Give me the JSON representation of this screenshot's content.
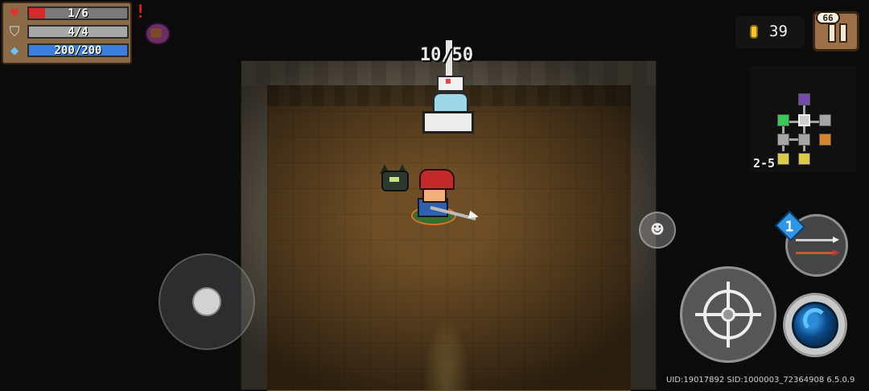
{
  "hud": {
    "health": {
      "icon": "heart-icon",
      "text": "1/6",
      "current": 1,
      "max": 6,
      "color": "#d62a2a"
    },
    "armor": {
      "icon": "shield-icon",
      "text": "4/4",
      "current": 4,
      "max": 4,
      "color": "#a7a7a7"
    },
    "energy": {
      "icon": "diamond-icon",
      "text": "200/200",
      "current": 200,
      "max": 200,
      "color": "#3a7ee0"
    },
    "alert": "!",
    "buff_icon": "purple-pouch-icon"
  },
  "gold": {
    "icon": "coin-icon",
    "value": "39"
  },
  "pause": {
    "badge": "66",
    "icon": "pause-icon"
  },
  "minimap": {
    "level": "2-5"
  },
  "machine": {
    "counter": "10/50"
  },
  "controls": {
    "joystick": "virtual-joystick",
    "emote_icon": "☻",
    "attack_icon": "crosshair-icon",
    "skill_icon": "water-swirl-icon",
    "weapon_count": "1"
  },
  "build_info": "UID:19017892 SID:1000003_72364908 6.5.0.9"
}
